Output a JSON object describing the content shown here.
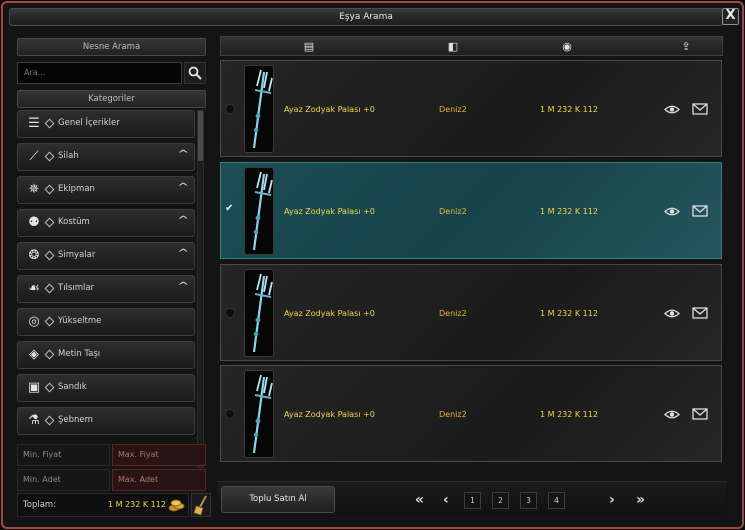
{
  "window": {
    "title": "Eşya Arama",
    "close": "X"
  },
  "left": {
    "search_header": "Nesne Arama",
    "search_placeholder": "Ara...",
    "categories_header": "Kategoriler",
    "categories": [
      {
        "label": "Genel İçerikler",
        "icon": "list-icon",
        "expandable": false
      },
      {
        "label": "Silah",
        "icon": "sword-icon",
        "expandable": true
      },
      {
        "label": "Ekipman",
        "icon": "armor-icon",
        "expandable": true
      },
      {
        "label": "Kostüm",
        "icon": "mask-icon",
        "expandable": true
      },
      {
        "label": "Simyalar",
        "icon": "dragon-stone-icon",
        "expandable": true
      },
      {
        "label": "Tılsımlar",
        "icon": "talisman-icon",
        "expandable": true
      },
      {
        "label": "Yükseltme",
        "icon": "upgrade-icon",
        "expandable": false
      },
      {
        "label": "Metin Taşı",
        "icon": "gem-icon",
        "expandable": false
      },
      {
        "label": "Sandık",
        "icon": "chest-icon",
        "expandable": false
      },
      {
        "label": "Şebnem",
        "icon": "potion-icon",
        "expandable": false
      }
    ],
    "filters": {
      "min_price": "Min. Fiyat",
      "max_price": "Max. Fiyat",
      "min_qty": "Min. Adet",
      "max_qty": "Max. Adet"
    },
    "total_label": "Toplam:",
    "total_value": "1 M 232 K 112"
  },
  "right": {
    "column_icons": [
      "item-icon",
      "seller-icon",
      "price-icon",
      "sort-icon"
    ],
    "rows": [
      {
        "name": "Ayaz Zodyak Palası +0",
        "seller": "Deniz2",
        "price": "1 M 232 K 112",
        "selected": false
      },
      {
        "name": "Ayaz Zodyak Palası +0",
        "seller": "Deniz2",
        "price": "1 M 232 K 112",
        "selected": true
      },
      {
        "name": "Ayaz Zodyak Palası +0",
        "seller": "Deniz2",
        "price": "1 M 232 K 112",
        "selected": false
      },
      {
        "name": "Ayaz Zodyak Palası +0",
        "seller": "Deniz2",
        "price": "1 M 232 K 112",
        "selected": false
      }
    ],
    "bulk_buy": "Toplu Satın Al",
    "pagination": {
      "pages": [
        "1",
        "2",
        "3",
        "4"
      ],
      "first": "«",
      "prev": "‹",
      "next": "›",
      "last": "»"
    }
  },
  "colors": {
    "price": "#f3d64d",
    "seller": "#e8b338",
    "selected_row": "#1c4d55",
    "window_border": "#9b4a40"
  }
}
